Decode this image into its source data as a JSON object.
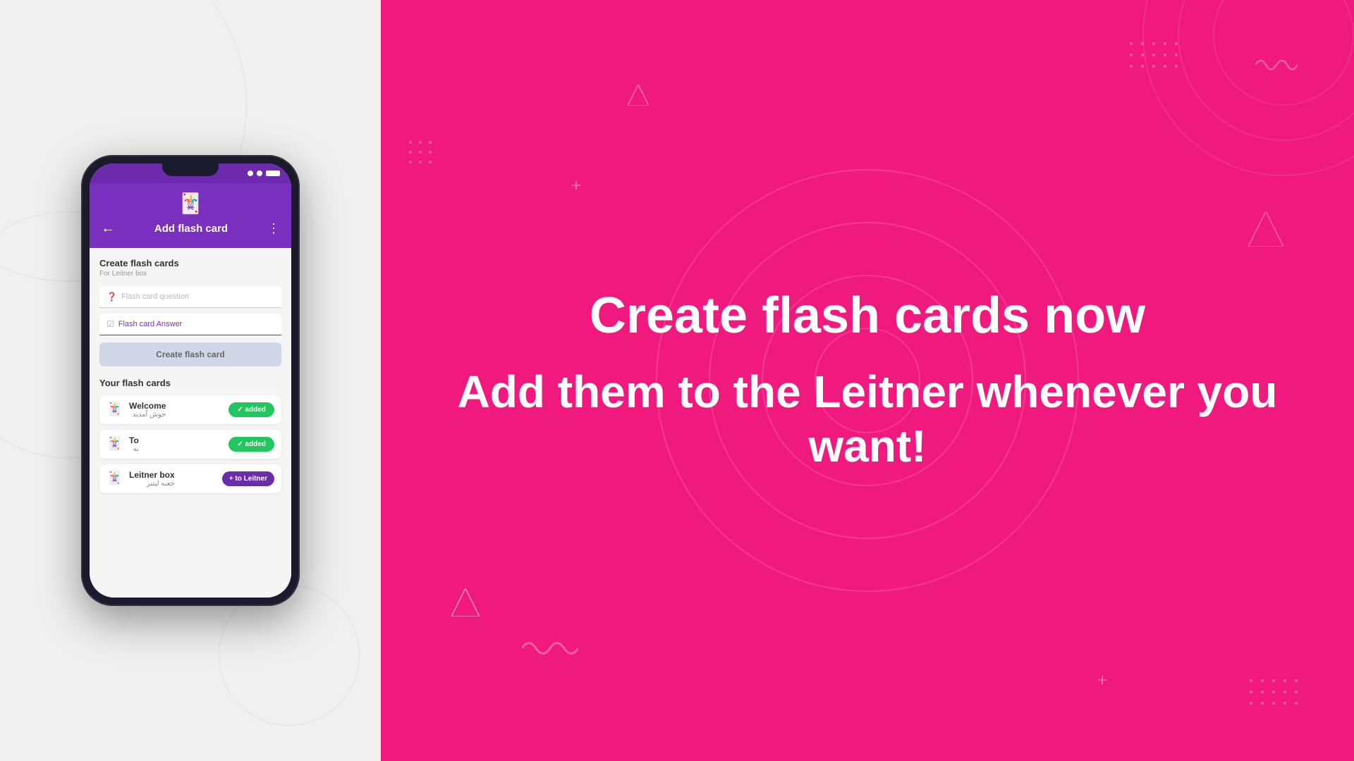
{
  "left_panel": {
    "bg_color": "#eeeeee"
  },
  "phone": {
    "status_bar_bg": "#6c2aad",
    "header_bg": "#7b2fbe",
    "app_title": "Add flash card",
    "back_icon": "←",
    "more_icon": "⋮",
    "logo_icon": "🃏",
    "create_section": {
      "title": "Create flash cards",
      "subtitle": "For Leitner box",
      "question_placeholder": "Flash card question",
      "answer_placeholder": "Flash card Answer",
      "create_button_label": "Create flash card"
    },
    "your_cards": {
      "title": "Your flash cards",
      "items": [
        {
          "word": "Welcome",
          "translation": "خوش آمدید",
          "status": "added",
          "status_label": "✓ added"
        },
        {
          "word": "To",
          "translation": "به",
          "status": "added",
          "status_label": "✓ added"
        },
        {
          "word": "Leitner box",
          "translation": "جعبه لیتنر",
          "status": "leitner",
          "status_label": "+ to Leitner"
        }
      ]
    }
  },
  "right_panel": {
    "bg_color": "#f0197d",
    "heading1": "Create flash cards now",
    "heading2": "Add them to the Leitner whenever you want!"
  }
}
